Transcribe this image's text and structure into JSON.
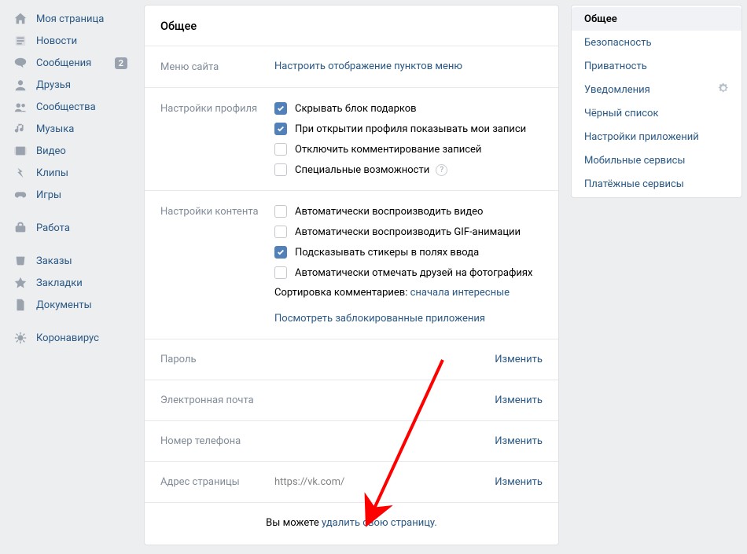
{
  "left_nav": {
    "items": [
      {
        "label": "Моя страница",
        "icon": "home"
      },
      {
        "label": "Новости",
        "icon": "news"
      },
      {
        "label": "Сообщения",
        "icon": "msg",
        "badge": "2"
      },
      {
        "label": "Друзья",
        "icon": "user"
      },
      {
        "label": "Сообщества",
        "icon": "group"
      },
      {
        "label": "Музыка",
        "icon": "music"
      },
      {
        "label": "Видео",
        "icon": "video"
      },
      {
        "label": "Клипы",
        "icon": "clips"
      },
      {
        "label": "Игры",
        "icon": "game"
      }
    ],
    "items2": [
      {
        "label": "Работа",
        "icon": "work"
      }
    ],
    "items3": [
      {
        "label": "Заказы",
        "icon": "orders"
      },
      {
        "label": "Закладки",
        "icon": "star"
      },
      {
        "label": "Документы",
        "icon": "doc"
      }
    ],
    "items4": [
      {
        "label": "Коронавирус",
        "icon": "virus"
      }
    ]
  },
  "main": {
    "title": "Общее",
    "site_menu": {
      "label": "Меню сайта",
      "link": "Настроить отображение пунктов меню"
    },
    "profile": {
      "label": "Настройки профиля",
      "opts": [
        {
          "text": "Скрывать блок подарков",
          "checked": true
        },
        {
          "text": "При открытии профиля показывать мои записи",
          "checked": true
        },
        {
          "text": "Отключить комментирование записей",
          "checked": false
        },
        {
          "text": "Специальные возможности",
          "checked": false,
          "help": true
        }
      ]
    },
    "content": {
      "label": "Настройки контента",
      "opts": [
        {
          "text": "Автоматически воспроизводить видео",
          "checked": false
        },
        {
          "text": "Автоматически воспроизводить GIF-анимации",
          "checked": false
        },
        {
          "text": "Подсказывать стикеры в полях ввода",
          "checked": true
        },
        {
          "text": "Автоматически отмечать друзей на фотографиях",
          "checked": false
        }
      ],
      "sort_label": "Сортировка комментариев: ",
      "sort_value": "сначала интересные",
      "blocked_link": "Посмотреть заблокированные приложения"
    },
    "rows": [
      {
        "label": "Пароль",
        "value": "",
        "action": "Изменить"
      },
      {
        "label": "Электронная почта",
        "value": "",
        "action": "Изменить"
      },
      {
        "label": "Номер телефона",
        "value": "",
        "action": "Изменить"
      },
      {
        "label": "Адрес страницы",
        "value": "https://vk.com/",
        "action": "Изменить"
      }
    ],
    "footer_prefix": "Вы можете ",
    "footer_link": "удалить свою страницу."
  },
  "right": {
    "items": [
      {
        "label": "Общее",
        "active": true
      },
      {
        "label": "Безопасность"
      },
      {
        "label": "Приватность"
      },
      {
        "label": "Уведомления",
        "gear": true
      },
      {
        "label": "Чёрный список"
      },
      {
        "label": "Настройки приложений"
      },
      {
        "label": "Мобильные сервисы"
      },
      {
        "label": "Платёжные сервисы"
      }
    ]
  }
}
